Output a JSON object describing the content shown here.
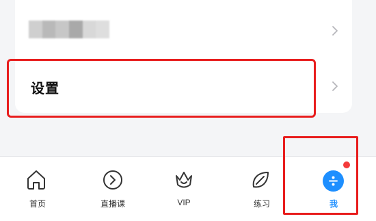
{
  "menu": {
    "blurred_item": {
      "swatches": [
        "#cfcfcf",
        "#b9b9b9",
        "#c7c7c7",
        "#a9a9a9",
        "#d8d8d8",
        "#dedede"
      ]
    },
    "settings_item": {
      "label": "设置"
    }
  },
  "tabbar": {
    "tabs": [
      {
        "label": "首页",
        "icon": "home-icon"
      },
      {
        "label": "直播课",
        "icon": "play-circle-icon"
      },
      {
        "label": "VIP",
        "icon": "crown-icon"
      },
      {
        "label": "练习",
        "icon": "leaf-icon"
      },
      {
        "label": "我",
        "icon": "profile-icon",
        "active": true,
        "badge": true
      }
    ]
  },
  "colors": {
    "accent": "#1e8fff",
    "highlight": "#e81d1d",
    "badge": "#f43b3b"
  }
}
